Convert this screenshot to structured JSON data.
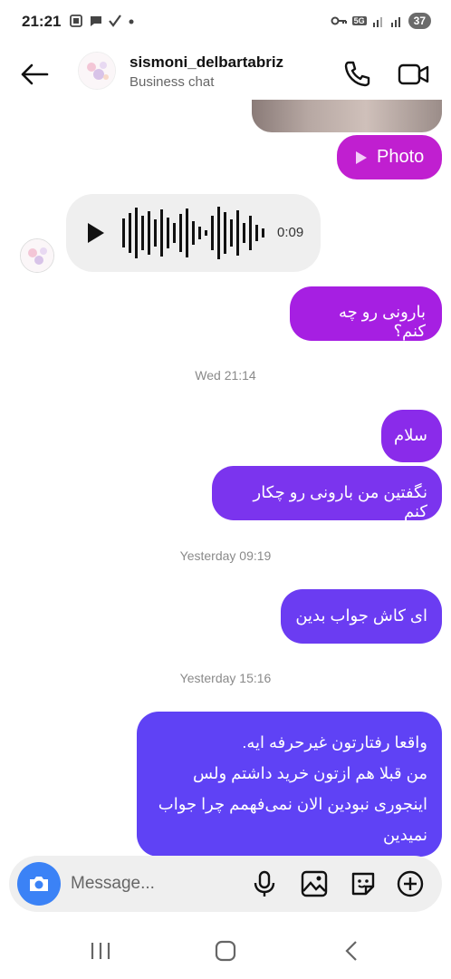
{
  "status_bar": {
    "time": "21:21",
    "battery": "37",
    "network_label": "5G"
  },
  "header": {
    "name": "sismoni_delbartabriz",
    "subtitle": "Business chat"
  },
  "messages": {
    "photo_label": "Photo",
    "voice_duration": "0:09",
    "m1": "بارونی رو چه کنم؟",
    "stamp1": "Wed 21:14",
    "m2": "سلام",
    "m3": "نگفتین من بارونی رو چکار کنم",
    "stamp2": "Yesterday 09:19",
    "m4": "ای کاش جواب بدین",
    "stamp3": "Yesterday 15:16",
    "m5_line1": "واقعا رفتارتون غیرحرفه ایه.",
    "m5_line2": "من قبلا هم ازتون خرید داشتم ولس",
    "m5_line3": "اینجوری نبودین الان نمی‌فهمم چرا جواب",
    "m5_line4": "نمیدین"
  },
  "composer": {
    "placeholder": "Message..."
  },
  "colors": {
    "photo_bubble": "#c01fd0",
    "bubble_top": "#a61fe2",
    "bubble_bottom": "#5f42f5",
    "camera_button": "#3b82f6"
  }
}
